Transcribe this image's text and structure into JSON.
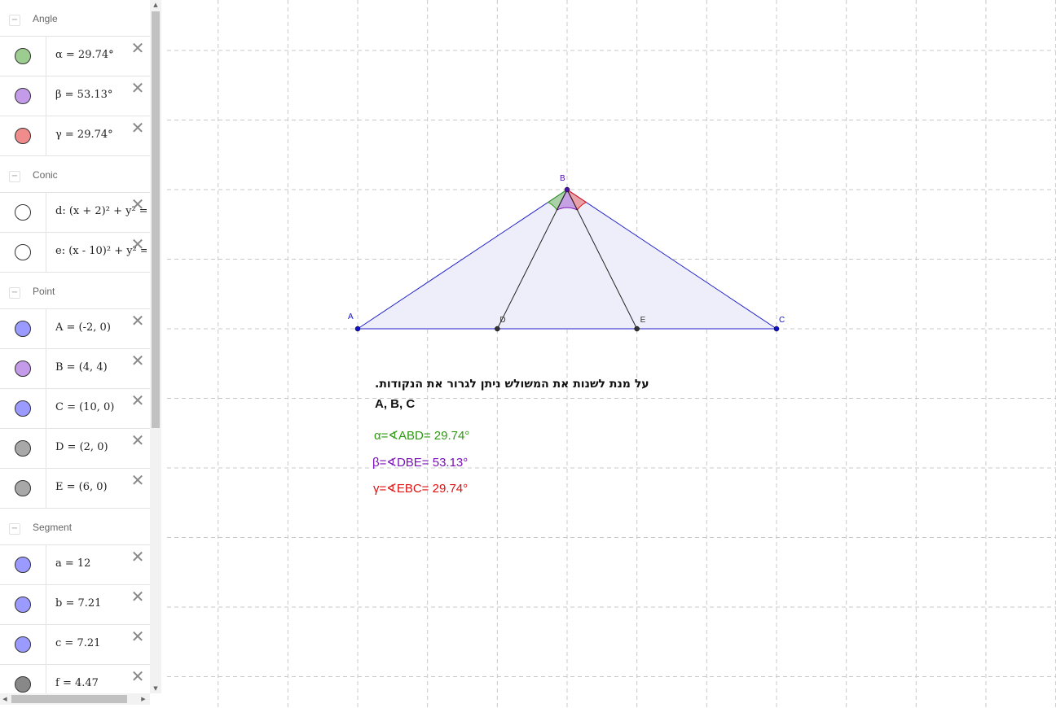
{
  "algebra": {
    "groups": [
      {
        "name": "Angle",
        "items": [
          {
            "formula": "α = 29.74°",
            "color": "#9ccc8f"
          },
          {
            "formula": "β = 53.13°",
            "color": "#c49be8"
          },
          {
            "formula": "γ = 29.74°",
            "color": "#f08c8c"
          }
        ]
      },
      {
        "name": "Conic",
        "items": [
          {
            "formula": "d: (x + 2)² + y² =",
            "color": "#ffffff"
          },
          {
            "formula": "e: (x - 10)² + y² =",
            "color": "#ffffff"
          }
        ]
      },
      {
        "name": "Point",
        "items": [
          {
            "formula": "A = (-2, 0)",
            "color": "#9b9bff"
          },
          {
            "formula": "B = (4, 4)",
            "color": "#c49be8"
          },
          {
            "formula": "C = (10, 0)",
            "color": "#9b9bff"
          },
          {
            "formula": "D = (2, 0)",
            "color": "#a8a8a8"
          },
          {
            "formula": "E = (6, 0)",
            "color": "#a8a8a8"
          }
        ]
      },
      {
        "name": "Segment",
        "items": [
          {
            "formula": "a = 12",
            "color": "#9b9bff"
          },
          {
            "formula": "b = 7.21",
            "color": "#9b9bff"
          },
          {
            "formula": "c = 7.21",
            "color": "#9b9bff"
          },
          {
            "formula": "f = 4.47",
            "color": "#888888"
          }
        ]
      }
    ],
    "collapse_symbol": "−",
    "close_symbol": "✕"
  },
  "graphics": {
    "points": [
      {
        "name": "A",
        "x": -2,
        "y": 0,
        "color": "#1010cc"
      },
      {
        "name": "B",
        "x": 4,
        "y": 4,
        "color": "#4b0ea8"
      },
      {
        "name": "C",
        "x": 10,
        "y": 0,
        "color": "#1010cc"
      },
      {
        "name": "D",
        "x": 2,
        "y": 0,
        "color": "#333333"
      },
      {
        "name": "E",
        "x": 6,
        "y": 0,
        "color": "#333333"
      }
    ],
    "instruction": "על מנת לשנות את המשולש ניתן לגרור את הנקודות.",
    "points_list": "A, B, C",
    "alpha_text": "α=∢ABD= 29.74°",
    "beta_text": "β=∢DBE= 53.13°",
    "gamma_text": "γ=∢EBC= 29.74°",
    "colors": {
      "triangle_fill": "#eeeefa",
      "triangle_stroke": "#2020cc",
      "alpha": "#2e9a12",
      "beta": "#7a10b8",
      "gamma": "#e01010"
    }
  }
}
